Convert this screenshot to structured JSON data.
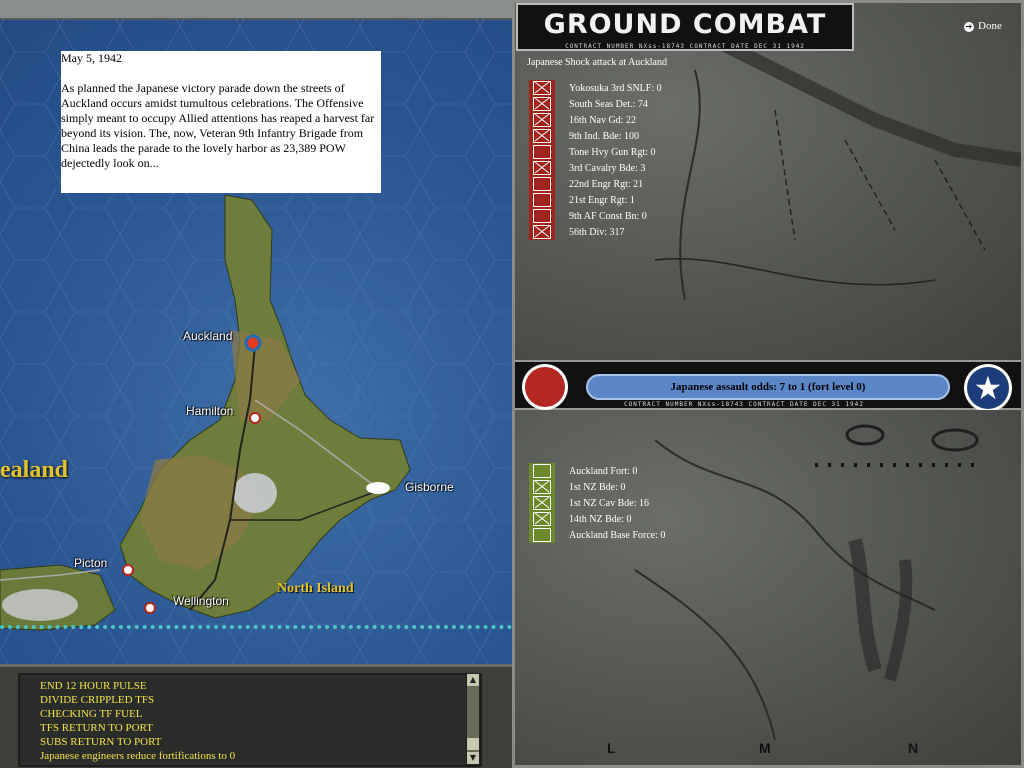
{
  "report": {
    "date": "May 5, 1942",
    "text": "As planned the Japanese victory parade down the streets of Auckland occurs amidst tumultous celebrations.  The Offensive simply meant to occupy Allied attentions has reaped a harvest far beyond its vision.  The, now, Veteran 9th Infantry Brigade from China leads the parade to the lovely harbor as 23,389 POW dejectedly look on..."
  },
  "map_labels": {
    "auckland": "Auckland",
    "hamilton": "Hamilton",
    "gisborne": "Gisborne",
    "picton": "Picton",
    "wellington": "Wellington",
    "north_island": "North Island",
    "zealand": "ealand"
  },
  "log": {
    "lines": [
      "END 12 HOUR PULSE",
      "DIVIDE CRIPPLED TFS",
      "CHECKING TF FUEL",
      "TFS RETURN TO PORT",
      "SUBS RETURN TO PORT",
      "Japanese engineers reduce fortifications to 0"
    ]
  },
  "combat": {
    "title": "GROUND COMBAT",
    "contract": "CONTRACT NUMBER  NXss-18743          CONTRACT DATE DEC 31 1942",
    "done_label": "Done",
    "subtitle": "Japanese Shock attack at Auckland",
    "odds": "Japanese assault odds: 7 to 1 (fort level 0)",
    "japanese_units": [
      "Yokosuka 3rd SNLF: 0",
      "South Seas Det.: 74",
      "16th Nav Gd: 22",
      "9th Ind. Bde: 100",
      "Tone Hvy Gun Rgt: 0",
      "3rd Cavalry Bde: 3",
      "22nd Engr Rgt: 21",
      "21st Engr Rgt: 1",
      "9th AF Const Bn: 0",
      "56th Div: 317"
    ],
    "allied_units": [
      "Auckland Fort: 0",
      "1st NZ Bde: 0",
      "1st NZ Cav Bde: 16",
      "14th NZ Bde: 0",
      "Auckland Base Force: 0"
    ],
    "grid_letters": [
      "L",
      "M",
      "N"
    ]
  },
  "colors": {
    "japan": "#b42822",
    "allied": "#1f3d7a",
    "log_text": "#f4e34a",
    "odds_pill": "#5b86c8"
  },
  "icons": {
    "done": "arrow-right-icon",
    "japan_roundel": "japan-roundel-icon",
    "us_star": "us-star-icon"
  }
}
